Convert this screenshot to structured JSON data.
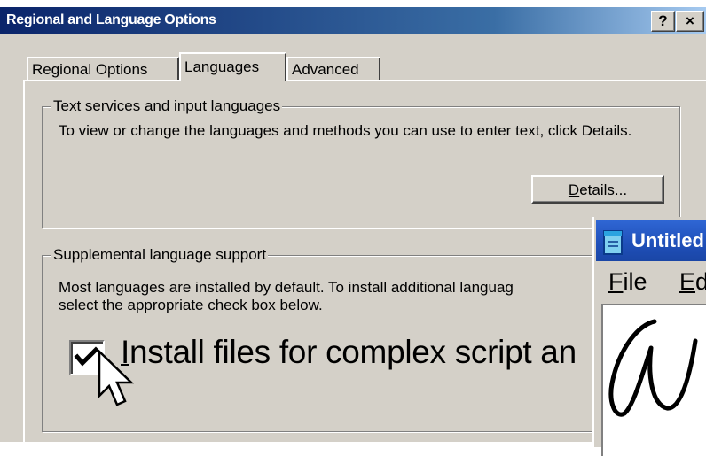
{
  "window": {
    "title": "Regional and Language Options",
    "help_label": "?",
    "close_label": "×"
  },
  "tabs": [
    {
      "label": "Regional Options",
      "selected": false
    },
    {
      "label": "Languages",
      "selected": true
    },
    {
      "label": "Advanced",
      "selected": false
    }
  ],
  "text_services": {
    "legend": "Text services and input languages",
    "description": "To view or change the languages and methods you can use to enter text, click Details.",
    "details_button": {
      "accel": "D",
      "rest": "etails..."
    }
  },
  "supplemental": {
    "legend": "Supplemental language support",
    "description_line1": "Most languages are installed by default. To install additional languag",
    "description_line2": "select the appropriate check box below.",
    "checkbox": {
      "checked": true,
      "label_accel": "I",
      "label_rest": "nstall files for complex script an"
    }
  },
  "second_window": {
    "title": "Untitled",
    "menu": [
      {
        "accel": "F",
        "rest": "ile"
      },
      {
        "accel": "E",
        "rest": "d"
      }
    ]
  },
  "icons": [
    "help-icon",
    "close-icon",
    "checkmark-icon",
    "mouse-pointer-icon",
    "notepad-icon"
  ]
}
